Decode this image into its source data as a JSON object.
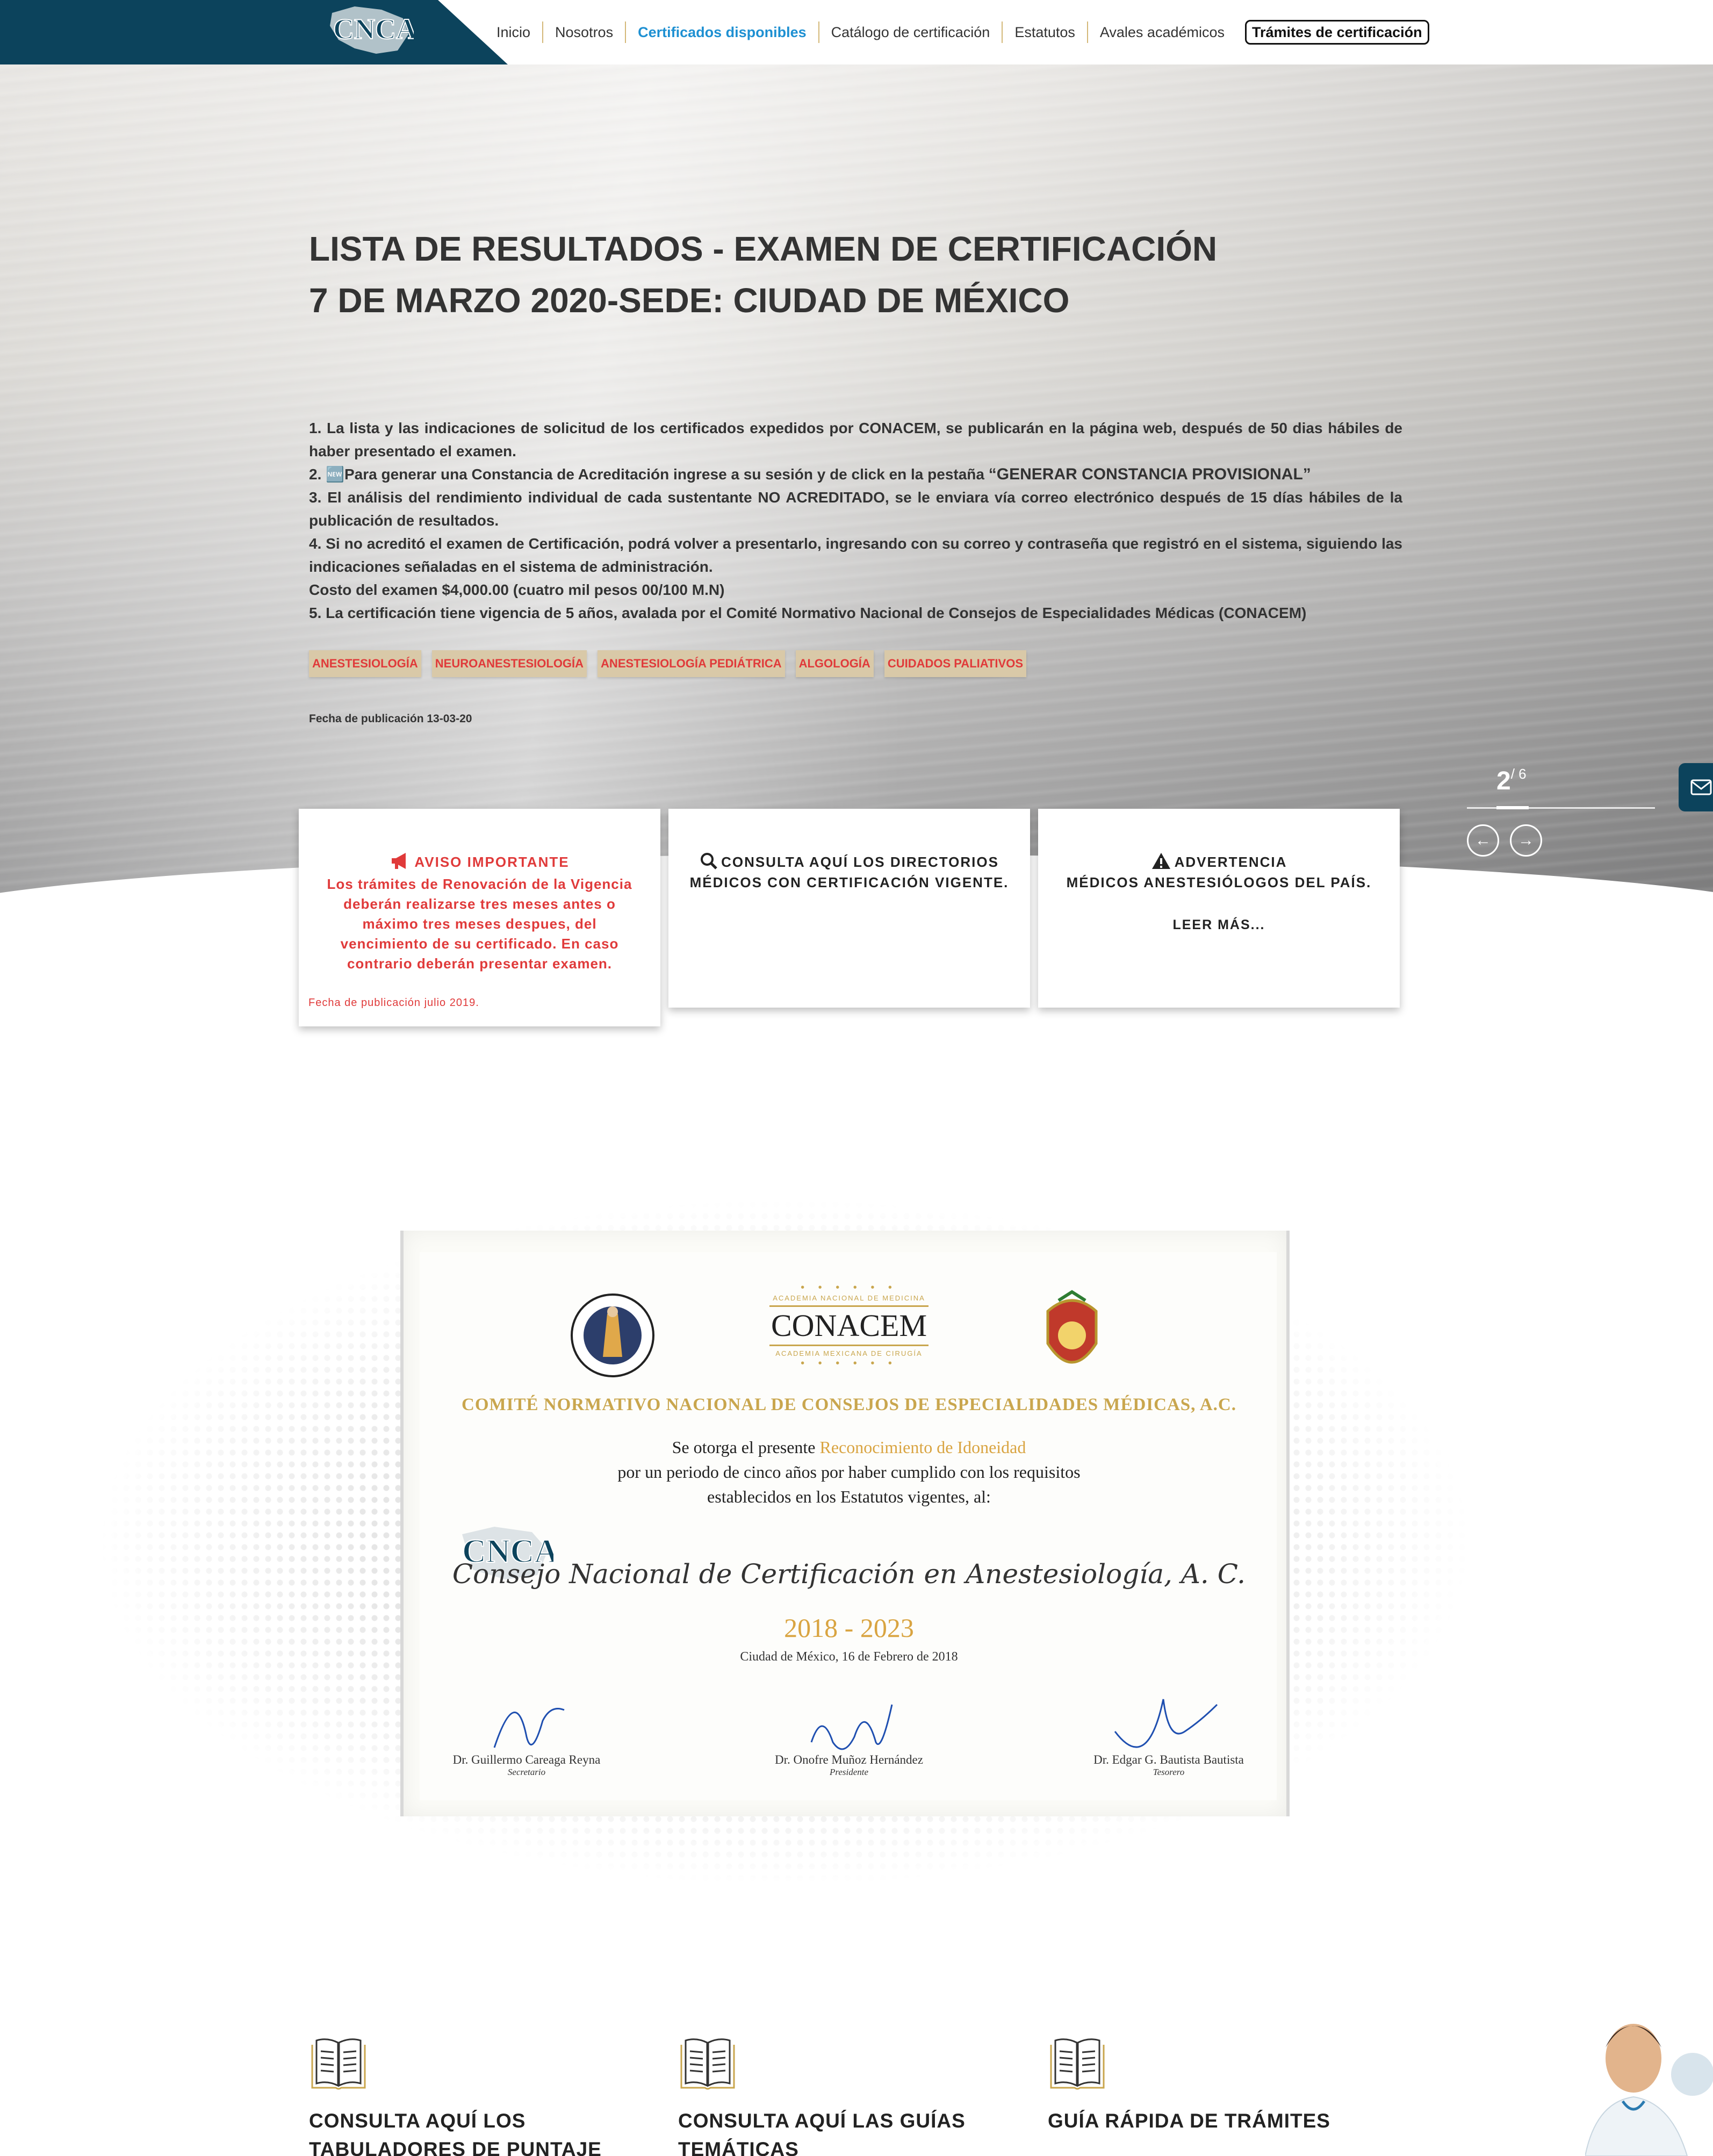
{
  "header": {
    "logo_alt": "CNCA",
    "nav": [
      {
        "label": "Inicio",
        "active": false
      },
      {
        "label": "Nosotros",
        "active": false
      },
      {
        "label": "Certificados disponibles",
        "active": true
      },
      {
        "label": "Catálogo de certificación",
        "active": false
      },
      {
        "label": "Estatutos",
        "active": false
      },
      {
        "label": "Avales académicos",
        "active": false
      }
    ],
    "cta_label": "Trámites de certificación",
    "brand_color": "#0c435c",
    "active_color": "#1e90d2"
  },
  "hero": {
    "title_line1": "LISTA DE RESULTADOS - EXAMEN DE CERTIFICACIÓN",
    "title_line2": "7 DE MARZO 2020-SEDE: CIUDAD DE MÉXICO",
    "items": [
      "1. La lista y las indicaciones de solicitud de los certificados expedidos por CONACEM, se publicarán en la página web, después de 50 dias hábiles de haber presentado el examen.",
      "2. 🆕Para generar una Constancia de Acreditación ingrese a su sesión y de click en la pestaña ",
      "“GENERAR CONSTANCIA PROVISIONAL”",
      "3. El análisis del rendimiento individual de cada sustentante NO ACREDITADO, se le enviara vía correo electrónico después de 15 días hábiles de la publicación de resultados.",
      "4. Si no acreditó el examen de Certificación, podrá volver a presentarlo, ingresando con su correo y contraseña que registró en el sistema, siguiendo las indicaciones señaladas en el sistema de administración.",
      "Costo del examen $4,000.00 (cuatro mil pesos 00/100 M.N)",
      "5. La certificación tiene vigencia de 5 años, avalada por el Comité Normativo Nacional de Consejos de Especialidades Médicas (CONACEM)"
    ],
    "tags": [
      "ANESTESIOLOGÍA",
      "NEUROANESTESIOLOGÍA",
      "ANESTESIOLOGÍA PEDIÁTRICA",
      "ALGOLOGÍA",
      "CUIDADOS PALIATIVOS"
    ],
    "pub_date": "Fecha de publicación 13-03-20",
    "slide_current": "2",
    "slide_total": "/ 6",
    "prev_icon": "arrow-left-icon",
    "next_icon": "arrow-right-icon"
  },
  "cards": {
    "notice": {
      "title": "AVISO IMPORTANTE",
      "icon": "megaphone-icon",
      "text": "Los trámites de Renovación de la Vigencia deberán realizarse tres meses antes o máximo tres meses despues, del vencimiento de su certificado. En caso contrario deberán presentar examen.",
      "date": "Fecha de publicación julio 2019.",
      "color": "#e03a3a"
    },
    "directory": {
      "icon": "search-icon",
      "title": "CONSULTA AQUÍ LOS DIRECTORIOS MÉDICOS CON CERTIFICACIÓN VIGENTE."
    },
    "warning": {
      "icon": "warning-icon",
      "title_line1": "ADVERTENCIA",
      "title_line2": "MÉDICOS ANESTESIÓLOGOS DEL PAÍS.",
      "read_more": "LEER MÁS..."
    }
  },
  "certificate": {
    "org_top": "ACADEMIA NACIONAL DE MEDICINA",
    "org_name": "CONACEM",
    "org_bottom": "ACADEMIA MEXICANA DE CIRUGÍA",
    "committee": "COMITÉ NORMATIVO NACIONAL DE CONSEJOS DE ESPECIALIDADES MÉDICAS, A.C.",
    "line1_pre": "Se otorga el presente ",
    "line1_gold": "Reconocimiento de Idoneidad",
    "line2": "por un periodo de cinco años por haber cumplido con los requisitos",
    "line3": "establecidos en los Estatutos vigentes, al:",
    "recipient": "Consejo Nacional de Certificación en Anestesiología, A. C.",
    "years": "2018 - 2023",
    "place_date": "Ciudad de México, 16 de Febrero de 2018",
    "signatures": [
      {
        "name": "Dr. Guillermo Careaga Reyna",
        "role": "Secretario"
      },
      {
        "name": "Dr. Onofre Muñoz Hernández",
        "role": "Presidente"
      },
      {
        "name": "Dr. Edgar G. Bautista Bautista",
        "role": "Tesorero"
      }
    ],
    "gold_color": "#c9a64e"
  },
  "features": [
    {
      "icon": "open-book-icon",
      "title": "CONSULTA AQUÍ LOS TABULADORES DE PUNTAJE"
    },
    {
      "icon": "open-book-icon",
      "title": "CONSULTA AQUÍ LAS GUÍAS TEMÁTICAS"
    },
    {
      "icon": "open-book-icon",
      "title": "GUÍA RÁPIDA DE TRÁMITES"
    }
  ]
}
